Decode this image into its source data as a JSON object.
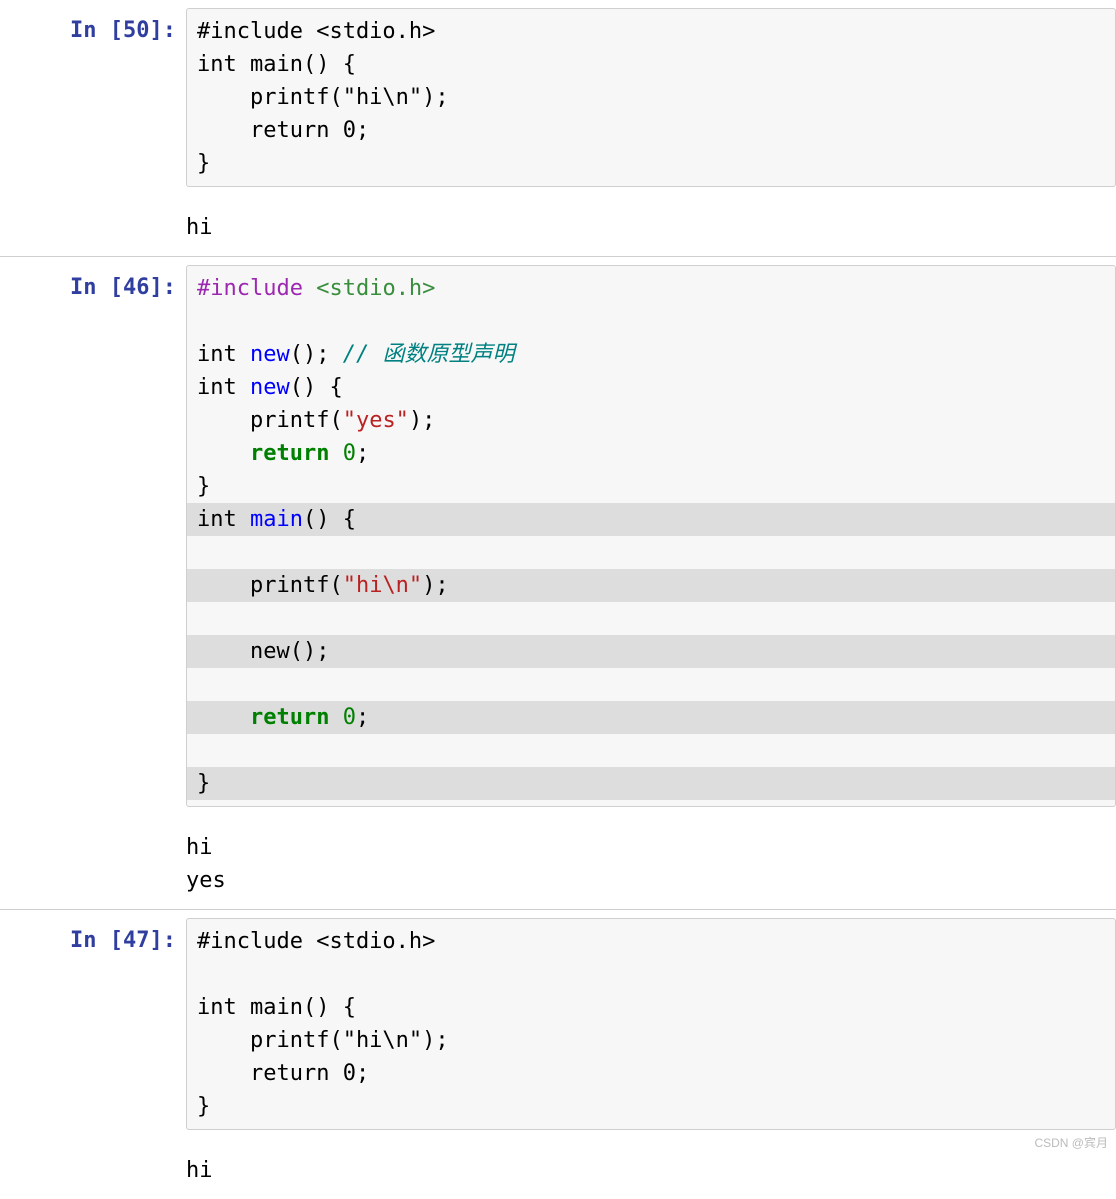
{
  "watermark": "CSDN @宾月",
  "cells": [
    {
      "prompt": "In [50]:",
      "plain": true,
      "code_raw": "#include <stdio.h>\nint main() {\n    printf(\"hi\\n\");\n    return 0;\n}",
      "outputs": [
        "hi"
      ]
    },
    {
      "prompt": "In [46]:",
      "plain": false,
      "tokens": [
        [
          [
            "pre",
            "#include"
          ],
          [
            "plain",
            " "
          ],
          [
            "pre2",
            "<stdio.h>"
          ]
        ],
        [],
        [
          [
            "type",
            "int"
          ],
          [
            "plain",
            " "
          ],
          [
            "func",
            "new"
          ],
          [
            "plain",
            "(); "
          ],
          [
            "cmt",
            "// 函数原型声明"
          ]
        ],
        [
          [
            "type",
            "int"
          ],
          [
            "plain",
            " "
          ],
          [
            "func",
            "new"
          ],
          [
            "plain",
            "() {"
          ]
        ],
        [
          [
            "plain",
            "    printf("
          ],
          [
            "str",
            "\"yes\""
          ],
          [
            "plain",
            ");"
          ]
        ],
        [
          [
            "plain",
            "    "
          ],
          [
            "kw",
            "return"
          ],
          [
            "plain",
            " "
          ],
          [
            "num",
            "0"
          ],
          [
            "plain",
            ";"
          ]
        ],
        [
          [
            "plain",
            "}"
          ]
        ],
        [
          [
            "type",
            "int"
          ],
          [
            "plain",
            " "
          ],
          [
            "func",
            "main"
          ],
          [
            "plain",
            "() {"
          ]
        ],
        [
          [
            "plain",
            "    printf("
          ],
          [
            "str",
            "\"hi\\n\""
          ],
          [
            "plain",
            ");"
          ]
        ],
        [
          [
            "plain",
            "    new();"
          ]
        ],
        [
          [
            "plain",
            "    "
          ],
          [
            "kw",
            "return"
          ],
          [
            "plain",
            " "
          ],
          [
            "num",
            "0"
          ],
          [
            "plain",
            ";"
          ]
        ],
        [
          [
            "plain",
            "}"
          ]
        ]
      ],
      "highlight_from": 7,
      "outputs": [
        "hi",
        "yes"
      ]
    },
    {
      "prompt": "In [47]:",
      "plain": true,
      "code_raw": "#include <stdio.h>\n\nint main() {\n    printf(\"hi\\n\");\n    return 0;\n}",
      "outputs": [
        "hi"
      ]
    }
  ]
}
